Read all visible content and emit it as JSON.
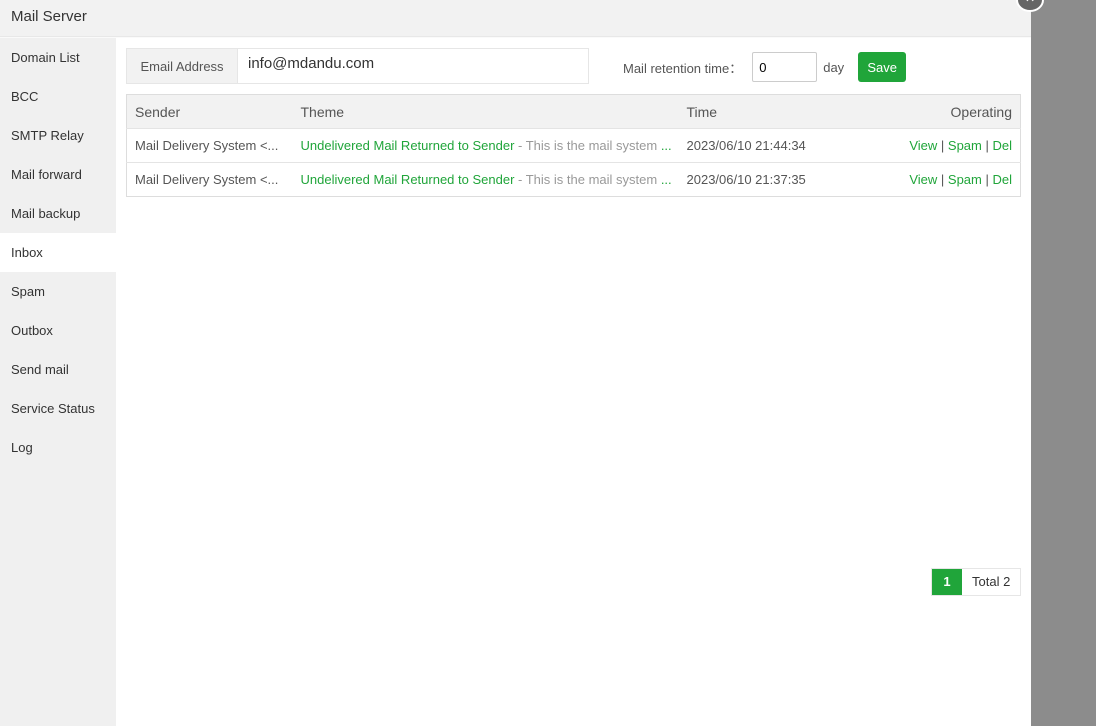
{
  "title": "Mail Server",
  "sidebar": {
    "items": [
      {
        "label": "Domain List"
      },
      {
        "label": "BCC"
      },
      {
        "label": "SMTP Relay"
      },
      {
        "label": "Mail forward"
      },
      {
        "label": "Mail backup"
      },
      {
        "label": "Inbox",
        "active": true
      },
      {
        "label": "Spam"
      },
      {
        "label": "Outbox"
      },
      {
        "label": "Send mail"
      },
      {
        "label": "Service Status"
      },
      {
        "label": "Log"
      }
    ]
  },
  "email": {
    "label": "Email Address",
    "value": "info@mdandu.com"
  },
  "retention": {
    "label": "Mail retention time：",
    "value": "0",
    "unit": "day",
    "save": "Save"
  },
  "table": {
    "headers": [
      "Sender",
      "Theme",
      "Time",
      "Operating"
    ],
    "rows": [
      {
        "sender": "Mail Delivery System <...",
        "subject": "Undelivered Mail Returned to Sender",
        "preview": " - This is the mail system ",
        "more": "...",
        "time": "2023/06/10 21:44:34"
      },
      {
        "sender": "Mail Delivery System <...",
        "subject": "Undelivered Mail Returned to Sender",
        "preview": " - This is the mail system ",
        "more": "...",
        "time": "2023/06/10 21:37:35"
      }
    ],
    "ops": {
      "view": "View",
      "spam": "Spam",
      "del": "Del",
      "sep": " | "
    }
  },
  "pager": {
    "current": "1",
    "total": "Total 2"
  },
  "accent": "#20a53a"
}
